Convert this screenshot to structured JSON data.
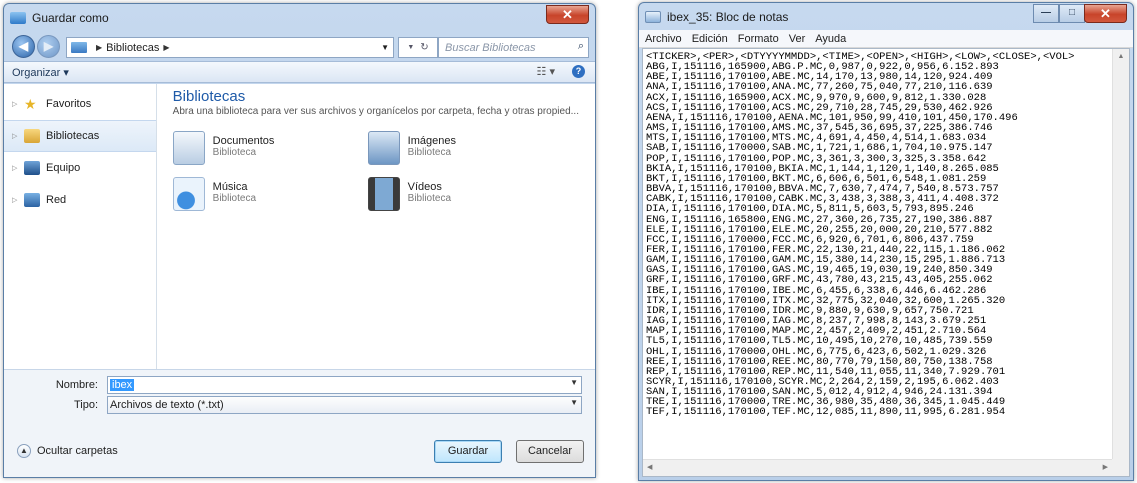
{
  "save_dialog": {
    "title": "Guardar como",
    "address": [
      "Bibliotecas"
    ],
    "search_placeholder": "Buscar Bibliotecas",
    "organize_label": "Organizar ▾",
    "nav": [
      {
        "label": "Favoritos",
        "icon": "star-icon"
      },
      {
        "label": "Bibliotecas",
        "icon": "library-icon",
        "selected": true
      },
      {
        "label": "Equipo",
        "icon": "computer-icon"
      },
      {
        "label": "Red",
        "icon": "network-icon"
      }
    ],
    "content_title": "Bibliotecas",
    "content_desc": "Abra una biblioteca para ver sus archivos y organícelos por carpeta, fecha y otras propied...",
    "libraries": [
      {
        "name": "Documentos",
        "type": "Biblioteca",
        "icon": "documents-library-icon"
      },
      {
        "name": "Imágenes",
        "type": "Biblioteca",
        "icon": "pictures-library-icon"
      },
      {
        "name": "Música",
        "type": "Biblioteca",
        "icon": "music-library-icon"
      },
      {
        "name": "Vídeos",
        "type": "Biblioteca",
        "icon": "videos-library-icon"
      }
    ],
    "filename_label": "Nombre:",
    "filename_value": "ibex",
    "filetype_label": "Tipo:",
    "filetype_value": "Archivos de texto (*.txt)",
    "hide_folders_label": "Ocultar carpetas",
    "save_button": "Guardar",
    "cancel_button": "Cancelar"
  },
  "notepad": {
    "title": "ibex_35: Bloc de notas",
    "menu": [
      "Archivo",
      "Edición",
      "Formato",
      "Ver",
      "Ayuda"
    ],
    "lines": [
      "<TICKER>,<PER>,<DTYYYYMMDD>,<TIME>,<OPEN>,<HIGH>,<LOW>,<CLOSE>,<VOL>",
      "ABG,I,151116,165900,ABG.P.MC,0,987,0,922,0,956,6.152.893",
      "ABE,I,151116,170100,ABE.MC,14,170,13,980,14,120,924.409",
      "ANA,I,151116,170100,ANA.MC,77,260,75,040,77,210,116.639",
      "ACX,I,151116,165900,ACX.MC,9,970,9,600,9,812,1.330.028",
      "ACS,I,151116,170100,ACS.MC,29,710,28,745,29,530,462.926",
      "AENA,I,151116,170100,AENA.MC,101,950,99,410,101,450,170.496",
      "AMS,I,151116,170100,AMS.MC,37,545,36,695,37,225,386.746",
      "MTS,I,151116,170100,MTS.MC,4,691,4,450,4,514,1.683.034",
      "SAB,I,151116,170000,SAB.MC,1,721,1,686,1,704,10.975.147",
      "POP,I,151116,170100,POP.MC,3,361,3,300,3,325,3.358.642",
      "BKIA,I,151116,170100,BKIA.MC,1,144,1,120,1,140,8.265.085",
      "BKT,I,151116,170100,BKT.MC,6,606,6,501,6,548,1.081.259",
      "BBVA,I,151116,170100,BBVA.MC,7,630,7,474,7,540,8.573.757",
      "CABK,I,151116,170100,CABK.MC,3,438,3,388,3,411,4.408.372",
      "DIA,I,151116,170100,DIA.MC,5,811,5,603,5,793,895.246",
      "ENG,I,151116,165800,ENG.MC,27,360,26,735,27,190,386.887",
      "ELE,I,151116,170100,ELE.MC,20,255,20,000,20,210,577.882",
      "FCC,I,151116,170000,FCC.MC,6,920,6,701,6,806,437.759",
      "FER,I,151116,170100,FER.MC,22,130,21,440,22,115,1.186.062",
      "GAM,I,151116,170100,GAM.MC,15,380,14,230,15,295,1.886.713",
      "GAS,I,151116,170100,GAS.MC,19,465,19,030,19,240,850.349",
      "GRF,I,151116,170100,GRF.MC,43,780,43,215,43,405,255.062",
      "IBE,I,151116,170100,IBE.MC,6,455,6,338,6,446,6.462.286",
      "ITX,I,151116,170100,ITX.MC,32,775,32,040,32,600,1.265.320",
      "IDR,I,151116,170100,IDR.MC,9,880,9,630,9,657,750.721",
      "IAG,I,151116,170100,IAG.MC,8,237,7,998,8,143,3.679.251",
      "MAP,I,151116,170100,MAP.MC,2,457,2,409,2,451,2.710.564",
      "TL5,I,151116,170100,TL5.MC,10,495,10,270,10,485,739.559",
      "OHL,I,151116,170000,OHL.MC,6,775,6,423,6,502,1.029.326",
      "REE,I,151116,170100,REE.MC,80,770,79,150,80,750,138.758",
      "REP,I,151116,170100,REP.MC,11,540,11,055,11,340,7.929.701",
      "SCYR,I,151116,170100,SCYR.MC,2,264,2,159,2,195,6.062.403",
      "SAN,I,151116,170100,SAN.MC,5,012,4,912,4,946,24.131.394",
      "TRE,I,151116,170000,TRE.MC,36,980,35,480,36,345,1.045.449",
      "TEF,I,151116,170100,TEF.MC,12,085,11,890,11,995,6.281.954"
    ]
  }
}
